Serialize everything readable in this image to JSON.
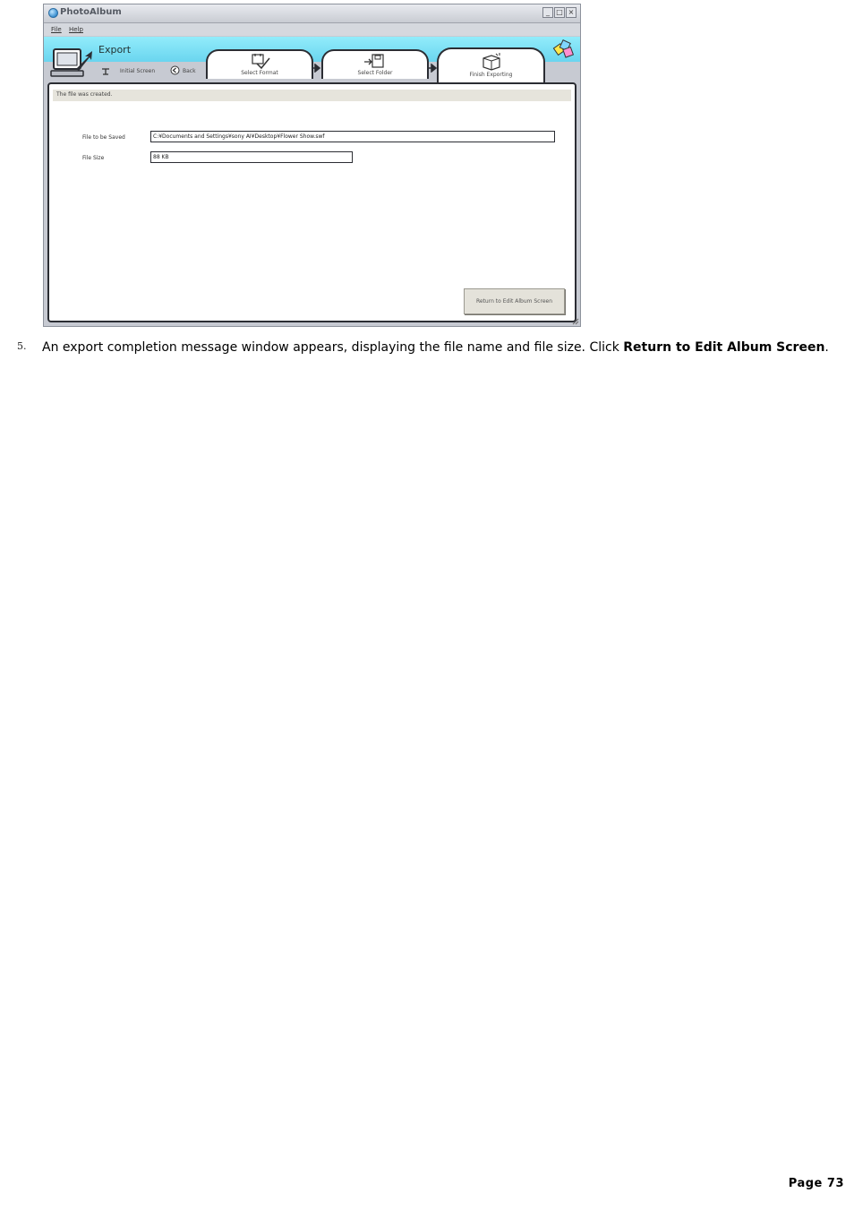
{
  "window": {
    "title": "PhotoAlbum",
    "controls": {
      "minimize": "_",
      "maximize": "□",
      "close": "×"
    },
    "menu": [
      {
        "label": "File"
      },
      {
        "label": "Help"
      }
    ]
  },
  "header": {
    "title": "Export",
    "nav": {
      "initial_screen": "Initial Screen",
      "back": "Back"
    },
    "steps": [
      {
        "label": "Select Format"
      },
      {
        "label": "Select Folder"
      },
      {
        "label": "Finish Exporting"
      }
    ]
  },
  "content": {
    "status": "The file was created.",
    "fields": [
      {
        "label": "File to be Saved",
        "value": "C:¥Documents and Settings¥sony AI¥Desktop¥Flower Show.swf"
      },
      {
        "label": "File Size",
        "value": "88 KB"
      }
    ],
    "return_button": "Return to Edit Album Screen"
  },
  "instruction": {
    "number": "5.",
    "text_before": "An export completion message window appears, displaying the file name and file size. Click ",
    "bold": "Return to Edit Album Screen",
    "text_after": "."
  },
  "footer": {
    "page": "Page 73"
  },
  "colors": {
    "header_cyan": "#7ee3f6",
    "window_gray": "#c7cad2",
    "status_strip": "#e6e4dc"
  }
}
